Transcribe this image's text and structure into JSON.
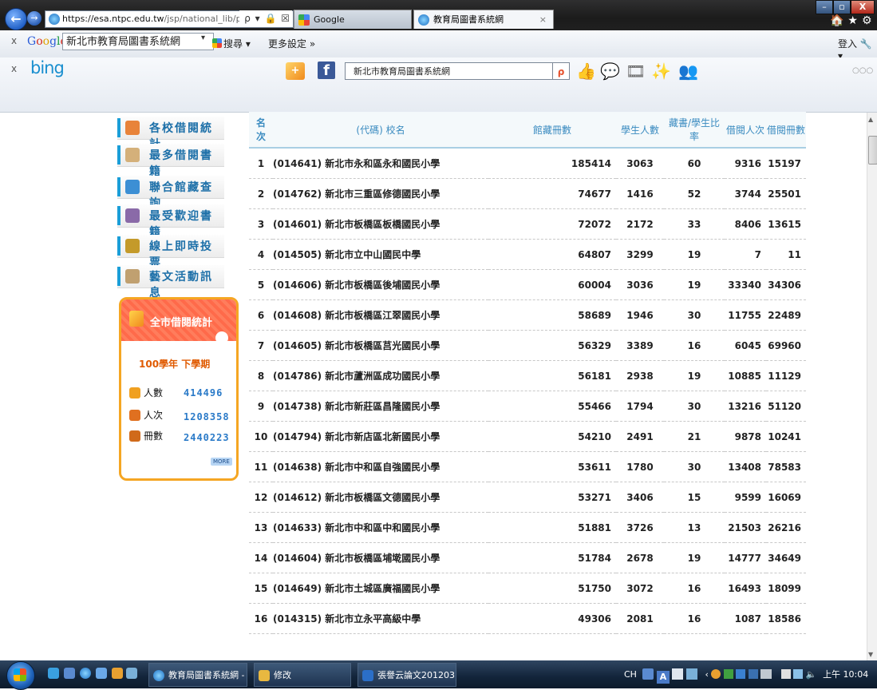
{
  "browser": {
    "url_main": "https://esa.ntpc.edu.tw",
    "url_rest": "/jsp/national_lib/pu",
    "addr_controls": "ρ ▾ 🔒 ☒ ↻ ✕",
    "tabs": [
      {
        "label": "Google",
        "close": ""
      },
      {
        "label": "教育局圖書系統網",
        "close": "×"
      }
    ],
    "window_controls": {
      "min": "–",
      "max": "▫",
      "close": "X"
    },
    "toolbar_icons": "🏠★⚙"
  },
  "google_toolbar": {
    "close": "x",
    "logo": [
      "G",
      "o",
      "o",
      "g",
      "l",
      "e"
    ],
    "search_value": "新北市教育局圖書系統網",
    "search_button": "搜尋 ▾",
    "more_settings": "更多設定 »",
    "login": "登入 🔧 ▾"
  },
  "bing_toolbar": {
    "close": "x",
    "logo": "bing",
    "search_value": "新北市教育局圖書系統網",
    "more": "○○○"
  },
  "sidebar": {
    "items": [
      {
        "label": "各校借閱統計",
        "color": "#e8833a"
      },
      {
        "label": "最多借閱書籍",
        "color": "#d4b07a"
      },
      {
        "label": "聯合館藏查詢",
        "color": "#3c8fd4"
      },
      {
        "label": "最受歡迎書籍",
        "color": "#8a6aa8"
      },
      {
        "label": "線上即時投票",
        "color": "#c49a2a"
      },
      {
        "label": "藝文活動訊息",
        "color": "#c0a070"
      }
    ],
    "stats": {
      "title": "全市借閱統計",
      "term": "100學年 下學期",
      "rows": [
        {
          "label": "人數",
          "value": "414496"
        },
        {
          "label": "人次",
          "value": "1208358"
        },
        {
          "label": "冊數",
          "value": "2440223"
        }
      ],
      "more": "MORE"
    }
  },
  "table": {
    "headers": [
      "名次",
      "(代碼) 校名",
      "館藏冊數",
      "學生人數",
      "藏書/學生比率",
      "借閱人次",
      "借閱冊數"
    ],
    "rows": [
      [
        "1",
        "(014641) 新北市永和區永和國民小學",
        "185414",
        "3063",
        "60",
        "9316",
        "15197"
      ],
      [
        "2",
        "(014762) 新北市三重區修德國民小學",
        "74677",
        "1416",
        "52",
        "3744",
        "25501"
      ],
      [
        "3",
        "(014601) 新北市板橋區板橋國民小學",
        "72072",
        "2172",
        "33",
        "8406",
        "13615"
      ],
      [
        "4",
        "(014505) 新北市立中山國民中學",
        "64807",
        "3299",
        "19",
        "7",
        "11"
      ],
      [
        "5",
        "(014606) 新北市板橋區後埔國民小學",
        "60004",
        "3036",
        "19",
        "33340",
        "34306"
      ],
      [
        "6",
        "(014608) 新北市板橋區江翠國民小學",
        "58689",
        "1946",
        "30",
        "11755",
        "22489"
      ],
      [
        "7",
        "(014605) 新北市板橋區莒光國民小學",
        "56329",
        "3389",
        "16",
        "6045",
        "69960"
      ],
      [
        "8",
        "(014786) 新北市蘆洲區成功國民小學",
        "56181",
        "2938",
        "19",
        "10885",
        "11129"
      ],
      [
        "9",
        "(014738) 新北市新莊區昌隆國民小學",
        "55466",
        "1794",
        "30",
        "13216",
        "51120"
      ],
      [
        "10",
        "(014794) 新北市新店區北新國民小學",
        "54210",
        "2491",
        "21",
        "9878",
        "10241"
      ],
      [
        "11",
        "(014638) 新北市中和區自強國民小學",
        "53611",
        "1780",
        "30",
        "13408",
        "78583"
      ],
      [
        "12",
        "(014612) 新北市板橋區文德國民小學",
        "53271",
        "3406",
        "15",
        "9599",
        "16069"
      ],
      [
        "13",
        "(014633) 新北市中和區中和國民小學",
        "51881",
        "3726",
        "13",
        "21503",
        "26216"
      ],
      [
        "14",
        "(014604) 新北市板橋區埔墘國民小學",
        "51784",
        "2678",
        "19",
        "14777",
        "34649"
      ],
      [
        "15",
        "(014649) 新北市土城區廣福國民小學",
        "51750",
        "3072",
        "16",
        "16493",
        "18099"
      ],
      [
        "16",
        "(014315) 新北市立永平高級中學",
        "49306",
        "2081",
        "16",
        "1087",
        "18586"
      ]
    ]
  },
  "taskbar": {
    "tasks": [
      {
        "label": "教育局圖書系統網 - ..."
      },
      {
        "label": "修改"
      },
      {
        "label": "張譽云論文201203..."
      }
    ],
    "tray_left": "CH",
    "clock": "上午 10:04"
  }
}
